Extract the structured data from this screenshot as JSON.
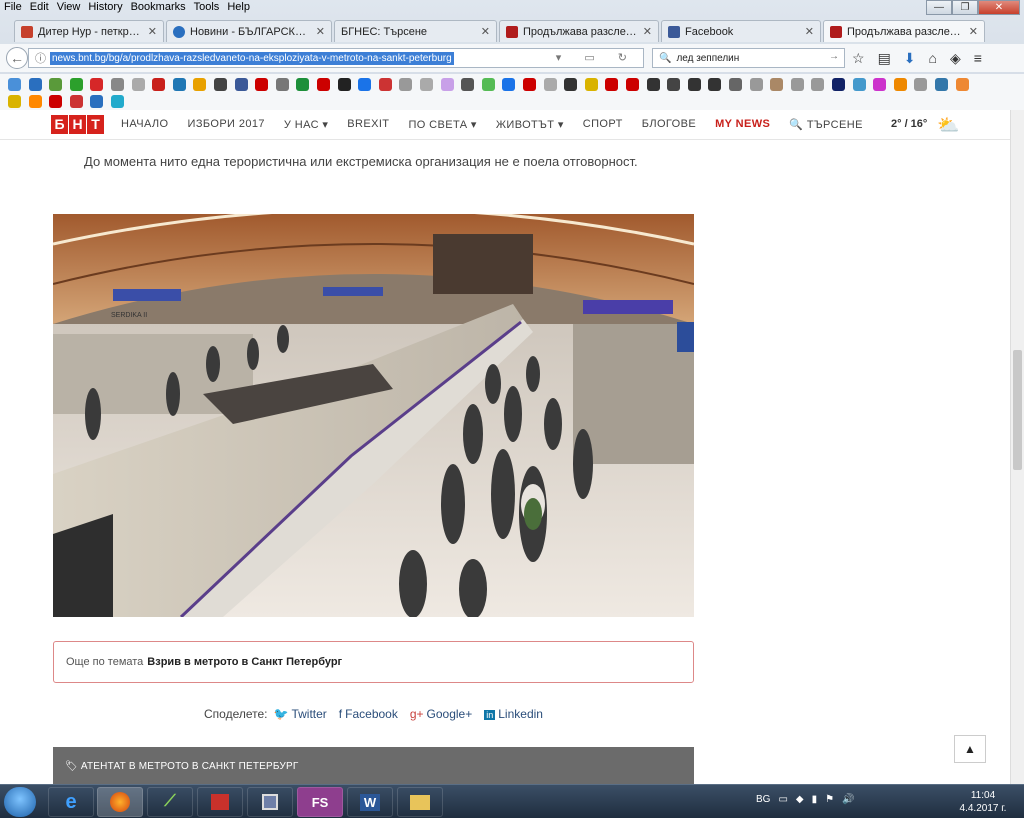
{
  "menubar": [
    "File",
    "Edit",
    "View",
    "History",
    "Bookmarks",
    "Tools",
    "Help"
  ],
  "tabs": [
    {
      "title": "Дитер Нур - петкратния...",
      "color": "#c6402c"
    },
    {
      "title": "Новини - БЪЛГАРСКА Т...",
      "color": "#2a6fbf"
    },
    {
      "title": "БГНЕС: Търсене",
      "color": "#999999"
    },
    {
      "title": "Продължава разследван...",
      "color": "#b01c1c"
    },
    {
      "title": "Facebook",
      "color": "#3b5998"
    },
    {
      "title": "Продължава разследван...",
      "color": "#b01c1c"
    }
  ],
  "url": "news.bnt.bg/bg/a/prodlzhava-razsledvaneto-na-eksploziyata-v-metroto-na-sankt-peterburg",
  "search_value": "лед зеппелин",
  "site": {
    "logo": [
      "Б",
      "Н",
      "Т"
    ],
    "nav": [
      {
        "label": "НАЧАЛО",
        "style": "normal"
      },
      {
        "label": "ИЗБОРИ 2017",
        "style": "normal"
      },
      {
        "label": "У НАС ▾",
        "style": "normal"
      },
      {
        "label": "BREXIT",
        "style": "normal"
      },
      {
        "label": "ПО СВЕТА ▾",
        "style": "normal"
      },
      {
        "label": "ЖИВОТЪТ ▾",
        "style": "normal"
      },
      {
        "label": "СПОРТ",
        "style": "normal"
      },
      {
        "label": "БЛОГОВЕ",
        "style": "normal"
      },
      {
        "label": "MY NEWS",
        "style": "red"
      },
      {
        "label": "🔍 ТЪРСЕНЕ",
        "style": "normal"
      }
    ],
    "weather": "2° / 16°"
  },
  "article": {
    "paragraph": "До момента нито една терористична или екстремиска организация не е поела отговорност.",
    "related_prefix": "Още по темата",
    "related_link": "Взрив в метрото в Санкт Петербург",
    "share_label": "Споделете:",
    "share": [
      {
        "icon": "🐦",
        "label": "Twitter"
      },
      {
        "icon": "f",
        "label": "Facebook"
      },
      {
        "icon": "g+",
        "label": "Google+"
      },
      {
        "icon": "in",
        "label": "Linkedin"
      }
    ],
    "topic_bar": "АТЕНТАТ В МЕТРОТО В САНКТ ПЕТЕРБУРГ",
    "photo_sign": "SERDIKA II"
  },
  "taskbar": {
    "lang": "BG",
    "time": "11:04",
    "date": "4.4.2017 г."
  }
}
